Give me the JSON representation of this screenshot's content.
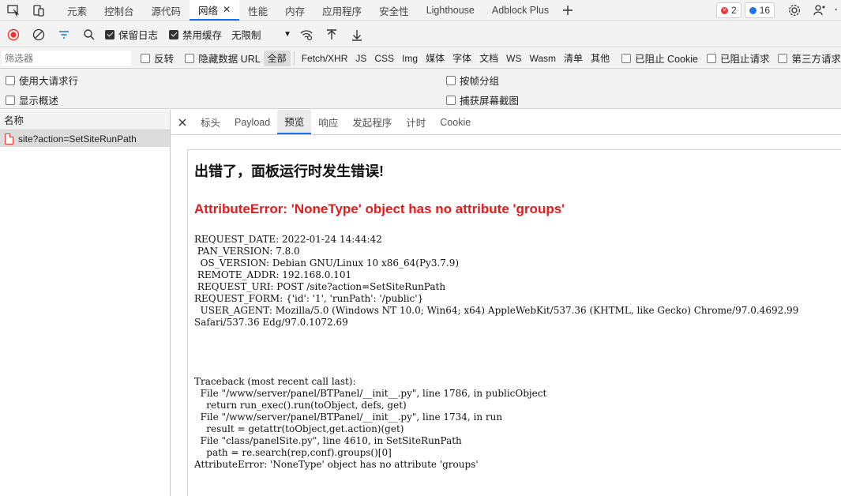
{
  "tabs": [
    {
      "label": "元素",
      "active": false
    },
    {
      "label": "控制台",
      "active": false
    },
    {
      "label": "源代码",
      "active": false
    },
    {
      "label": "网络",
      "active": true
    },
    {
      "label": "性能",
      "active": false
    },
    {
      "label": "内存",
      "active": false
    },
    {
      "label": "应用程序",
      "active": false
    },
    {
      "label": "安全性",
      "active": false
    },
    {
      "label": "Lighthouse",
      "active": false
    },
    {
      "label": "Adblock Plus",
      "active": false
    }
  ],
  "badges": {
    "errors": "2",
    "messages": "16"
  },
  "toolbar": {
    "preserve_log": "保留日志",
    "disable_cache": "禁用缓存",
    "throttle": "无限制"
  },
  "filter": {
    "placeholder": "筛选器",
    "invert": "反转",
    "hide_data_urls": "隐藏数据 URL",
    "types": [
      "全部",
      "Fetch/XHR",
      "JS",
      "CSS",
      "Img",
      "媒体",
      "字体",
      "文档",
      "WS",
      "Wasm",
      "清单",
      "其他"
    ],
    "blocked_cookies": "已阻止 Cookie",
    "blocked_requests": "已阻止请求",
    "third_party": "第三方请求"
  },
  "settings": {
    "large_rows": "使用大请求行",
    "overview": "显示概述",
    "group_by_frame": "按帧分组",
    "screenshots": "捕获屏幕截图"
  },
  "request_list": {
    "header": "名称",
    "rows": [
      "site?action=SetSiteRunPath"
    ]
  },
  "details": {
    "tabs": [
      "标头",
      "Payload",
      "预览",
      "响应",
      "发起程序",
      "计时",
      "Cookie"
    ],
    "active_tab": "预览"
  },
  "preview": {
    "title": "出错了，面板运行时发生错误!",
    "error": "AttributeError: 'NoneType' object has no attribute 'groups'",
    "request_info": "REQUEST_DATE: 2022-01-24 14:44:42\n PAN_VERSION: 7.8.0\n  OS_VERSION: Debian GNU/Linux 10 x86_64(Py3.7.9)\n REMOTE_ADDR: 192.168.0.101\n REQUEST_URI: POST /site?action=SetSiteRunPath\nREQUEST_FORM: {'id': '1', 'runPath': '/public'}\n  USER_AGENT: Mozilla/5.0 (Windows NT 10.0; Win64; x64) AppleWebKit/537.36 (KHTML, like Gecko) Chrome/97.0.4692.99\nSafari/537.36 Edg/97.0.1072.69",
    "traceback": "Traceback (most recent call last):\n  File \"/www/server/panel/BTPanel/__init__.py\", line 1786, in publicObject\n    return run_exec().run(toObject, defs, get)\n  File \"/www/server/panel/BTPanel/__init__.py\", line 1734, in run\n    result = getattr(toObject,get.action)(get)\n  File \"class/panelSite.py\", line 4610, in SetSiteRunPath\n    path = re.search(rep,conf).groups()[0]\nAttributeError: 'NoneType' object has no attribute 'groups'"
  }
}
